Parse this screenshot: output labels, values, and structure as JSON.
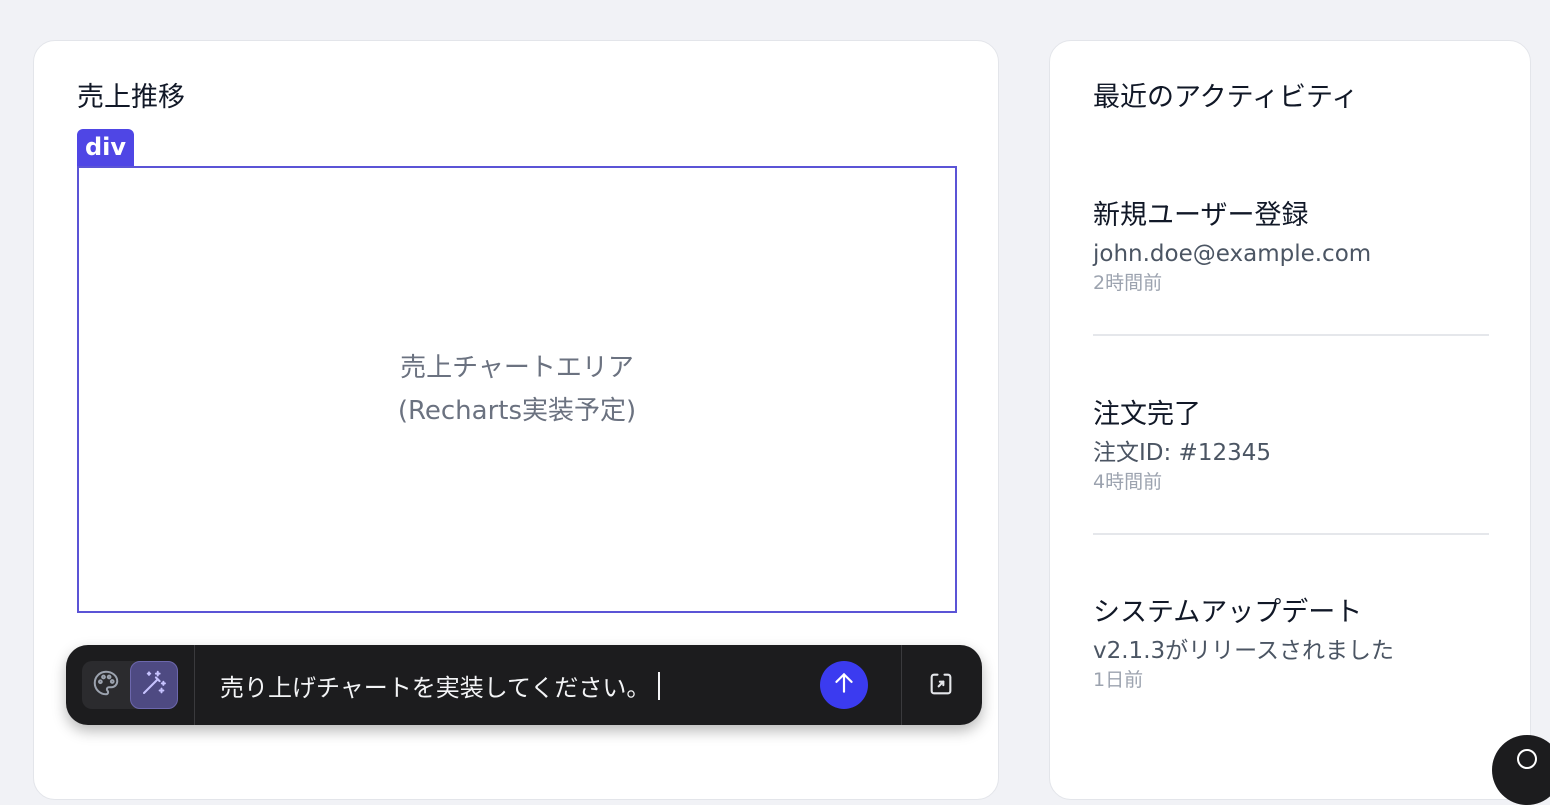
{
  "sales_card": {
    "title": "売上推移",
    "inspector_tag": "div",
    "placeholder_line1": "売上チャートエリア",
    "placeholder_line2": "(Recharts実装予定)"
  },
  "prompt_bar": {
    "input_value": "売り上げチャートを実装してください。",
    "icons": {
      "palette": "palette-icon",
      "wand": "magic-wand-icon",
      "send": "arrow-up-icon",
      "expand": "expand-window-icon"
    },
    "send_color": "#3b3bf0"
  },
  "activity_card": {
    "title": "最近のアクティビティ",
    "items": [
      {
        "title": "新規ユーザー登録",
        "detail": "john.doe@example.com",
        "time": "2時間前"
      },
      {
        "title": "注文完了",
        "detail": "注文ID: #12345",
        "time": "4時間前"
      },
      {
        "title": "システムアップデート",
        "detail": "v2.1.3がリリースされました",
        "time": "1日前"
      }
    ]
  },
  "colors": {
    "background": "#f1f2f6",
    "inspector_accent": "#4f46e5"
  }
}
